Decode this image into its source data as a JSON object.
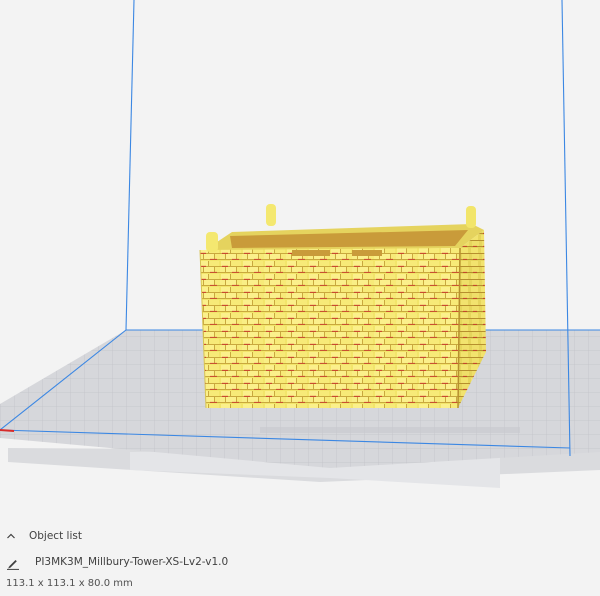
{
  "object_list": {
    "header_label": "Object list",
    "collapsed": false
  },
  "object": {
    "name": "PI3MK3M_Millbury-Tower-XS-Lv2-v1.0",
    "dimensions": "113.1 x 113.1 x 80.0 mm"
  },
  "colors": {
    "background": "#f3f3f3",
    "build_volume_edge": "#3b87e3",
    "build_plate": "#d4d5d9",
    "model": "#f4e870",
    "model_shadow": "#c8a23a",
    "overhang": "#d63025"
  },
  "icons": {
    "expand": "chevron-up-icon",
    "edit": "pencil-icon"
  }
}
